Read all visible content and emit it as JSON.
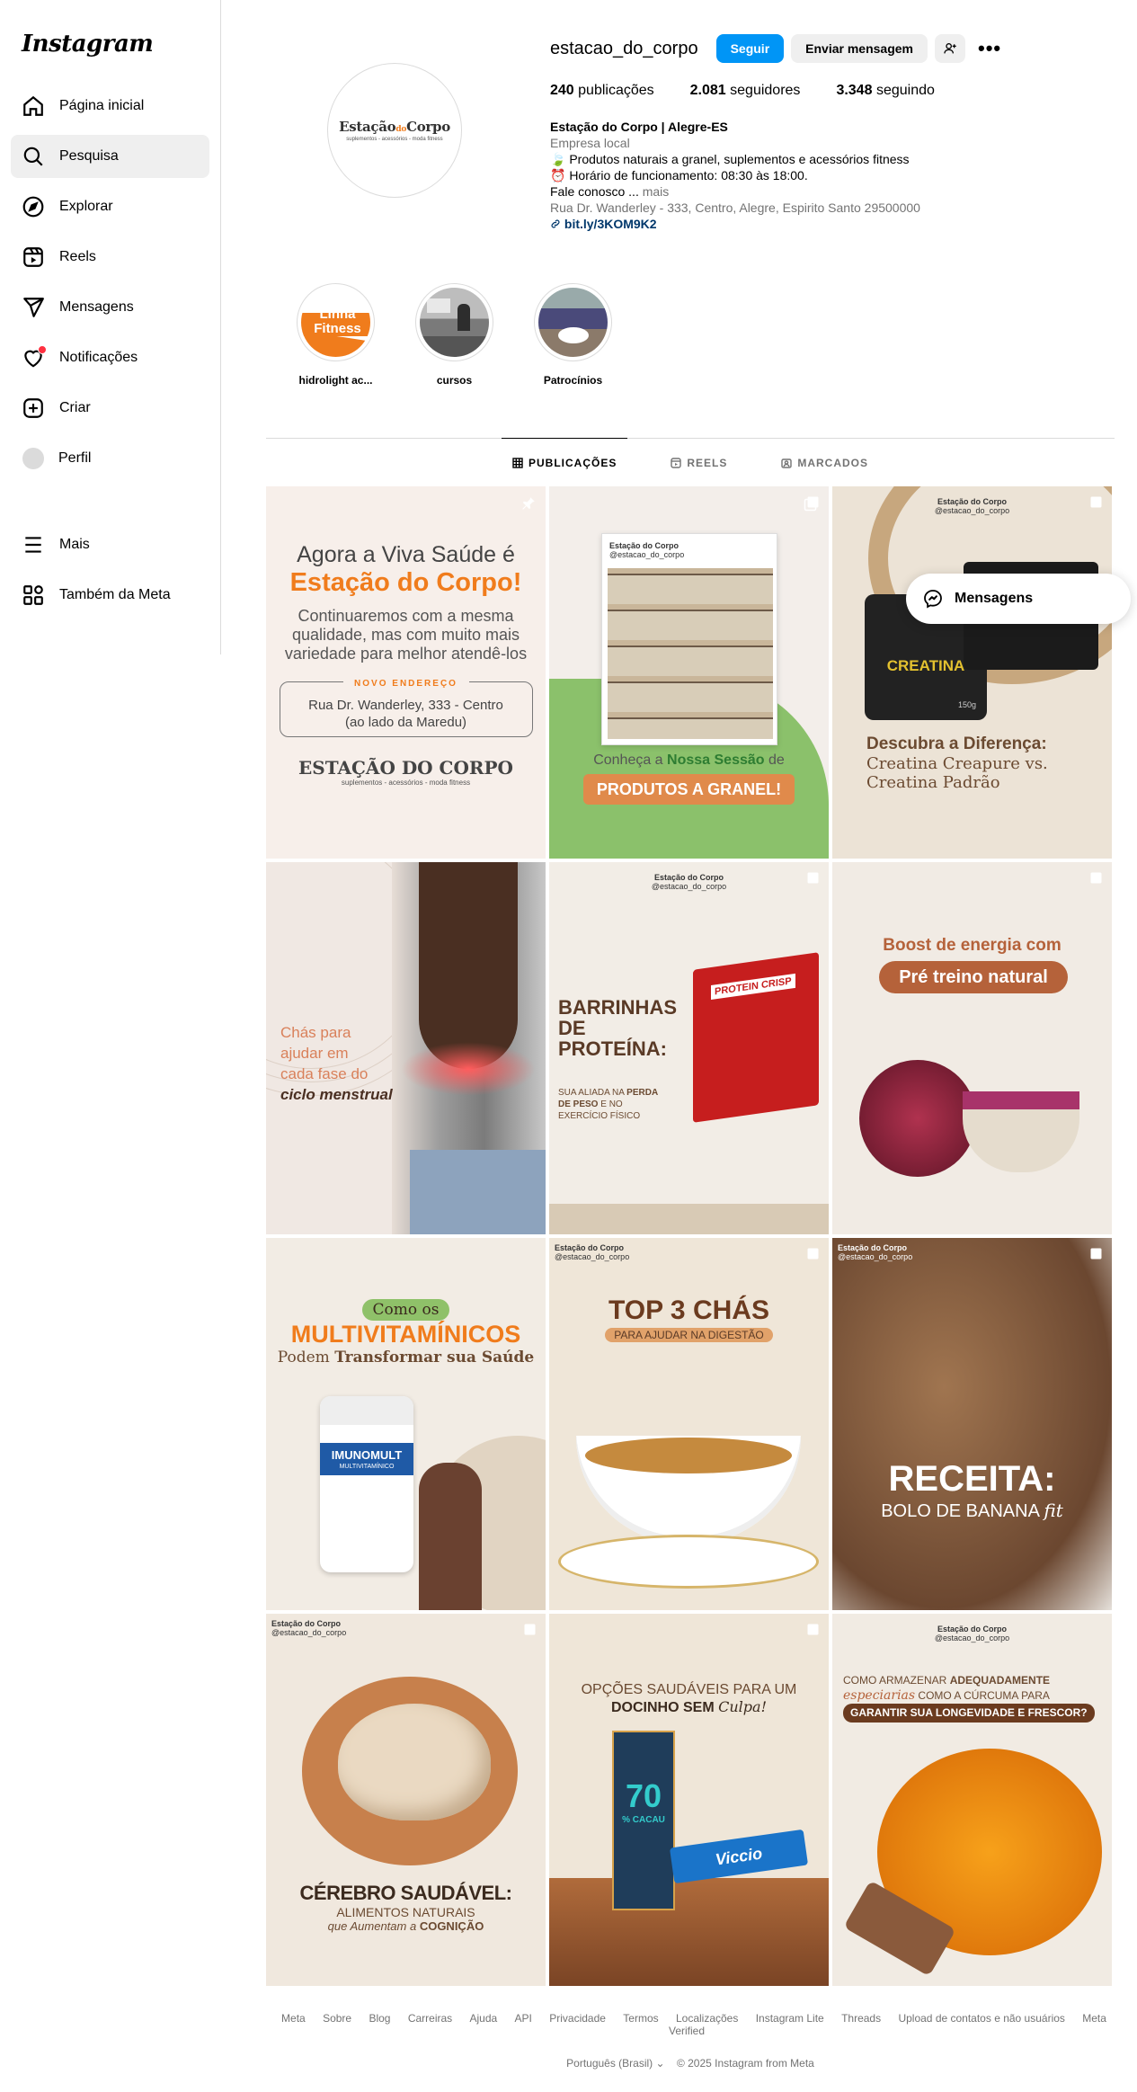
{
  "sidebar": {
    "logo": "Instagram",
    "items": [
      {
        "label": "Página inicial",
        "icon": "home-icon"
      },
      {
        "label": "Pesquisa",
        "icon": "search-icon"
      },
      {
        "label": "Explorar",
        "icon": "compass-icon"
      },
      {
        "label": "Reels",
        "icon": "reels-icon"
      },
      {
        "label": "Mensagens",
        "icon": "send-icon"
      },
      {
        "label": "Notificações",
        "icon": "heart-icon"
      },
      {
        "label": "Criar",
        "icon": "plus-square-icon"
      },
      {
        "label": "Perfil",
        "icon": "avatar"
      }
    ],
    "bottom_items": [
      {
        "label": "Mais",
        "icon": "menu-icon"
      },
      {
        "label": "Também da Meta",
        "icon": "meta-apps-icon"
      }
    ]
  },
  "profile": {
    "username": "estacao_do_corpo",
    "follow_label": "Seguir",
    "message_label": "Enviar mensagem",
    "pic_brand_a": "Estação",
    "pic_brand_b": "do",
    "pic_brand_c": "Corpo",
    "pic_tagline": "suplementos - acessórios - moda fitness",
    "stats": {
      "posts_count": "240",
      "posts_label": "publicações",
      "followers_count": "2.081",
      "followers_label": "seguidores",
      "following_count": "3.348",
      "following_label": "seguindo"
    },
    "bio": {
      "name": "Estação do Corpo | Alegre-ES",
      "category": "Empresa local",
      "line1": "🍃 Produtos naturais a granel, suplementos e acessórios fitness",
      "line2": "⏰ Horário de funcionamento: 08:30 às 18:00.",
      "line3": "Fale conosco ...",
      "more": "mais",
      "address": "Rua Dr. Wanderley - 333, Centro, Alegre, Espirito Santo 29500000",
      "link": "bit.ly/3KOM9K2"
    }
  },
  "highlights": [
    {
      "label": "hidrolight ac...",
      "text": "Linha Fitness"
    },
    {
      "label": "cursos"
    },
    {
      "label": "Patrocínios"
    }
  ],
  "tabs": [
    {
      "label": "PUBLICAÇÕES",
      "icon": "grid-icon"
    },
    {
      "label": "REELS",
      "icon": "reels-icon"
    },
    {
      "label": "MARCADOS",
      "icon": "tagged-icon"
    }
  ],
  "posts": {
    "p1": {
      "l1": "Agora a Viva Saúde é",
      "l2": "Estação do Corpo!",
      "l3": "Continuaremos com a mesma",
      "l4": "qualidade, mas com muito mais",
      "l5": "variedade para melhor atendê-los",
      "tag": "NOVO ENDEREÇO",
      "addr1": "Rua Dr. Wanderley, 333 - Centro",
      "addr2": "(ao lado da Maredu)",
      "brand": "ESTAÇÃO DO CORPO",
      "sub": "suplementos - acessórios - moda fitness"
    },
    "p2": {
      "h1": "Estação do Corpo",
      "h2": "@estacao_do_corpo",
      "l1a": "Conheça a ",
      "l1b": "Nossa Sessão",
      "l1c": " de",
      "btn": "PRODUTOS A GRANEL!"
    },
    "p3": {
      "h1": "Estação do Corpo",
      "h2": "@estacao_do_corpo",
      "jar": "CREATINA",
      "jar2": "150g",
      "l1": "Descubra a Diferença:",
      "l2": "Creatina Creapure vs.",
      "l3": "Creatina Padrão"
    },
    "p4": {
      "l1": "Chás para",
      "l2": "ajudar em",
      "l3": "cada fase do",
      "l4": "ciclo menstrual"
    },
    "p5": {
      "h1": "Estação do Corpo",
      "h2": "@estacao_do_corpo",
      "l1": "BARRINHAS",
      "l2": "DE",
      "l3": "PROTEÍNA:",
      "s1": "SUA ALIADA NA ",
      "s1b": "PERDA",
      "s2": "DE PESO",
      "s2b": " E NO",
      "s3": "EXERCÍCIO FÍSICO",
      "box": "PROTEIN CRISP"
    },
    "p6": {
      "l1": "Boost de energia com",
      "l2": "Pré treino natural"
    },
    "p7": {
      "pill": "Como os",
      "l1": "MULTIVITAMÍNICOS",
      "l2a": "Podem ",
      "l2b": "Transformar sua Saúde",
      "bottle": "IMUNOMULT",
      "bottle2": "MULTIVITAMÍNICO"
    },
    "p8": {
      "h1": "Estação do Corpo",
      "h2": "@estacao_do_corpo",
      "l1": "TOP 3 CHÁS",
      "l2": "PARA AJUDAR NA DIGESTÃO"
    },
    "p9": {
      "h1": "Estação do Corpo",
      "h2": "@estacao_do_corpo",
      "l1": "RECEITA:",
      "l2": "BOLO DE BANANA",
      "l3": "fit"
    },
    "p10": {
      "h1": "Estação do Corpo",
      "h2": "@estacao_do_corpo",
      "l1": "CÉREBRO SAUDÁVEL:",
      "l2": "ALIMENTOS NATURAIS",
      "l3a": "que Aumentam a ",
      "l3b": "COGNIÇÃO"
    },
    "p11": {
      "l1": "OPÇÕES SAUDÁVEIS PARA UM",
      "l2a": "DOCINHO SEM ",
      "l2b": "Culpa!",
      "choc1": "70",
      "choc2": "% CACAU",
      "bar": "Viccio"
    },
    "p12": {
      "h1": "Estação do Corpo",
      "h2": "@estacao_do_corpo",
      "l1a": "COMO ARMAZENAR ",
      "l1b": "ADEQUADAMENTE",
      "l2a": "especiarias",
      "l2b": " COMO A CÚRCUMA PARA",
      "l3": "GARANTIR SUA LONGEVIDADE E FRESCOR?"
    }
  },
  "floating": {
    "messages_label": "Mensagens"
  },
  "footer": {
    "links": [
      "Meta",
      "Sobre",
      "Blog",
      "Carreiras",
      "Ajuda",
      "API",
      "Privacidade",
      "Termos",
      "Localizações",
      "Instagram Lite",
      "Threads",
      "Upload de contatos e não usuários",
      "Meta Verified"
    ],
    "language": "Português (Brasil)",
    "copyright": "© 2025 Instagram from Meta"
  },
  "colors": {
    "accent": "#0095f6",
    "brand_orange": "#f07c1c",
    "brown": "#8a5a3c"
  }
}
